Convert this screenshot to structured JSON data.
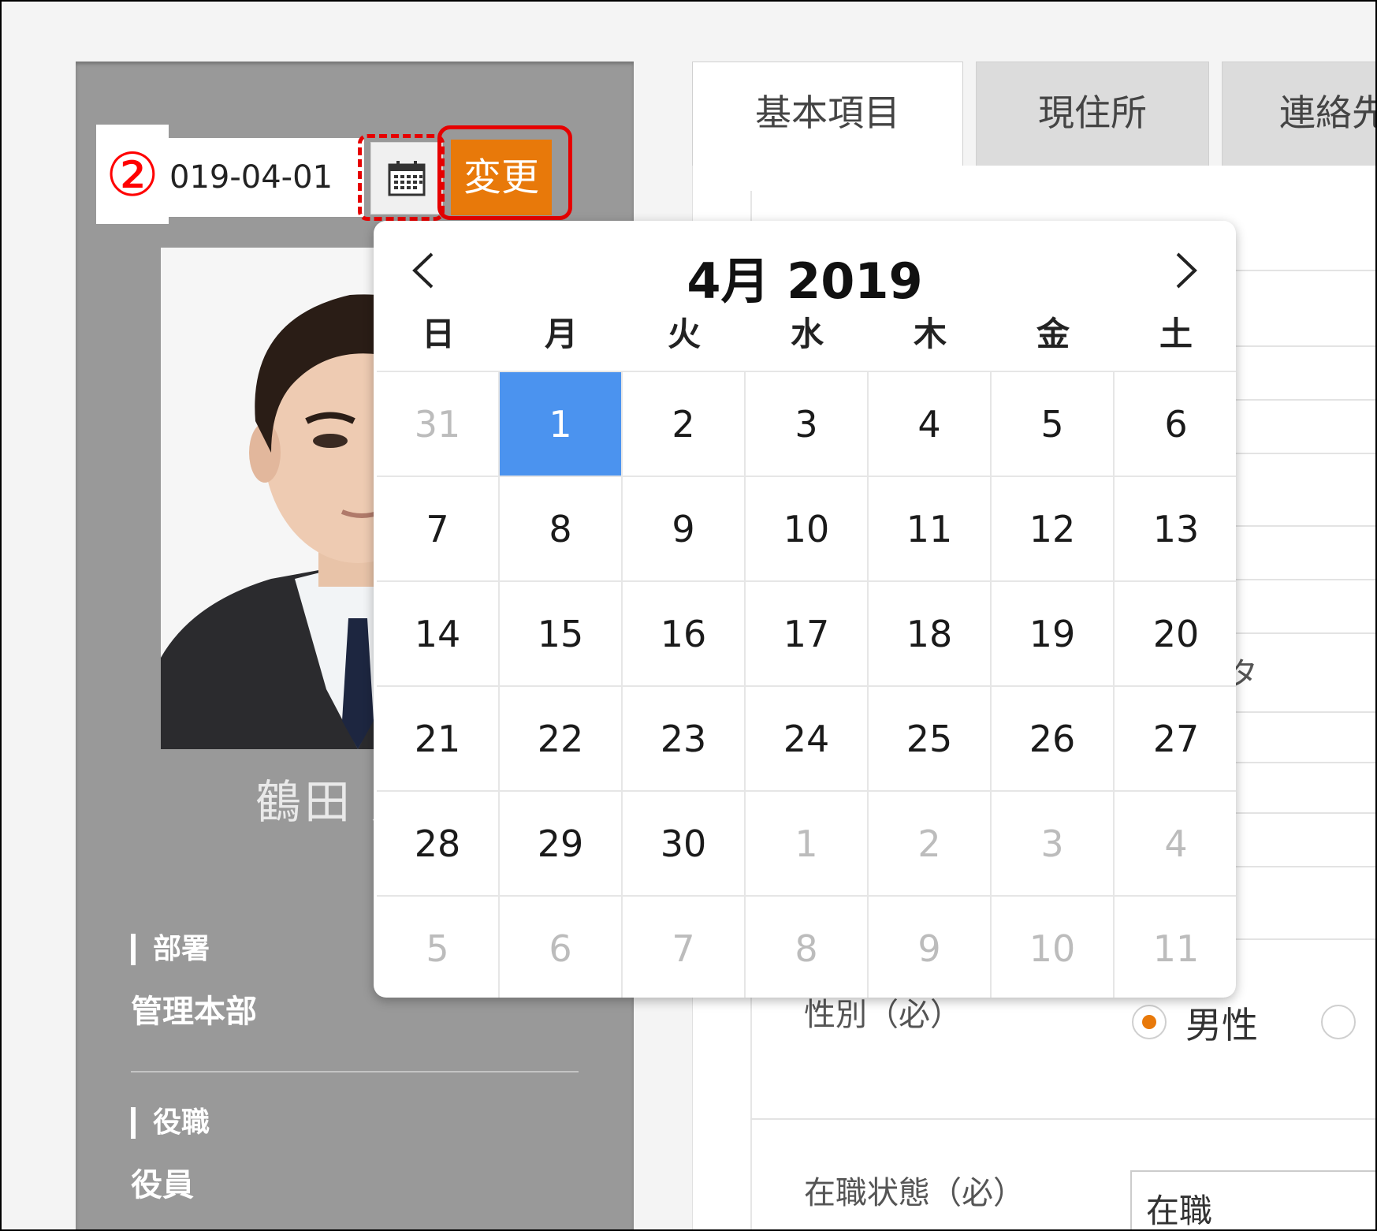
{
  "step_marker": "②",
  "date_field": {
    "value": "019-04-01"
  },
  "change_button": {
    "label": "変更",
    "color": "#e8790a"
  },
  "employee": {
    "name": "鶴田 嘉",
    "fields": [
      {
        "label": "部署",
        "value": "管理本部"
      },
      {
        "label": "役職",
        "value": "役員"
      }
    ]
  },
  "tabs": [
    {
      "label": "基本項目",
      "active": true
    },
    {
      "label": "現住所",
      "active": false
    },
    {
      "label": "連絡先",
      "active": false
    }
  ],
  "form": {
    "partial_text": "タ",
    "gender_label": "性別（必）",
    "gender_options": [
      {
        "label": "男性",
        "checked": true
      },
      {
        "label": "",
        "checked": false
      }
    ],
    "status_label": "在職状態（必）",
    "status_value": "在職"
  },
  "calendar": {
    "title": "4月 2019",
    "weekdays": [
      "日",
      "月",
      "火",
      "水",
      "木",
      "金",
      "土"
    ],
    "days": [
      {
        "d": "31",
        "m": true
      },
      {
        "d": "1",
        "sel": true
      },
      {
        "d": "2"
      },
      {
        "d": "3"
      },
      {
        "d": "4"
      },
      {
        "d": "5"
      },
      {
        "d": "6"
      },
      {
        "d": "7"
      },
      {
        "d": "8"
      },
      {
        "d": "9"
      },
      {
        "d": "10"
      },
      {
        "d": "11"
      },
      {
        "d": "12"
      },
      {
        "d": "13"
      },
      {
        "d": "14"
      },
      {
        "d": "15"
      },
      {
        "d": "16"
      },
      {
        "d": "17"
      },
      {
        "d": "18"
      },
      {
        "d": "19"
      },
      {
        "d": "20"
      },
      {
        "d": "21"
      },
      {
        "d": "22"
      },
      {
        "d": "23"
      },
      {
        "d": "24"
      },
      {
        "d": "25"
      },
      {
        "d": "26"
      },
      {
        "d": "27"
      },
      {
        "d": "28"
      },
      {
        "d": "29"
      },
      {
        "d": "30"
      },
      {
        "d": "1",
        "m": true
      },
      {
        "d": "2",
        "m": true
      },
      {
        "d": "3",
        "m": true
      },
      {
        "d": "4",
        "m": true
      },
      {
        "d": "5",
        "m": true
      },
      {
        "d": "6",
        "m": true
      },
      {
        "d": "7",
        "m": true
      },
      {
        "d": "8",
        "m": true
      },
      {
        "d": "9",
        "m": true
      },
      {
        "d": "10",
        "m": true
      },
      {
        "d": "11",
        "m": true
      }
    ],
    "selected_color": "#4b93ef"
  },
  "icons": {
    "calendar_button": "calendar-icon",
    "prev": "chevron-left-icon",
    "next": "chevron-right-icon"
  },
  "annotation_color": "#e60000"
}
